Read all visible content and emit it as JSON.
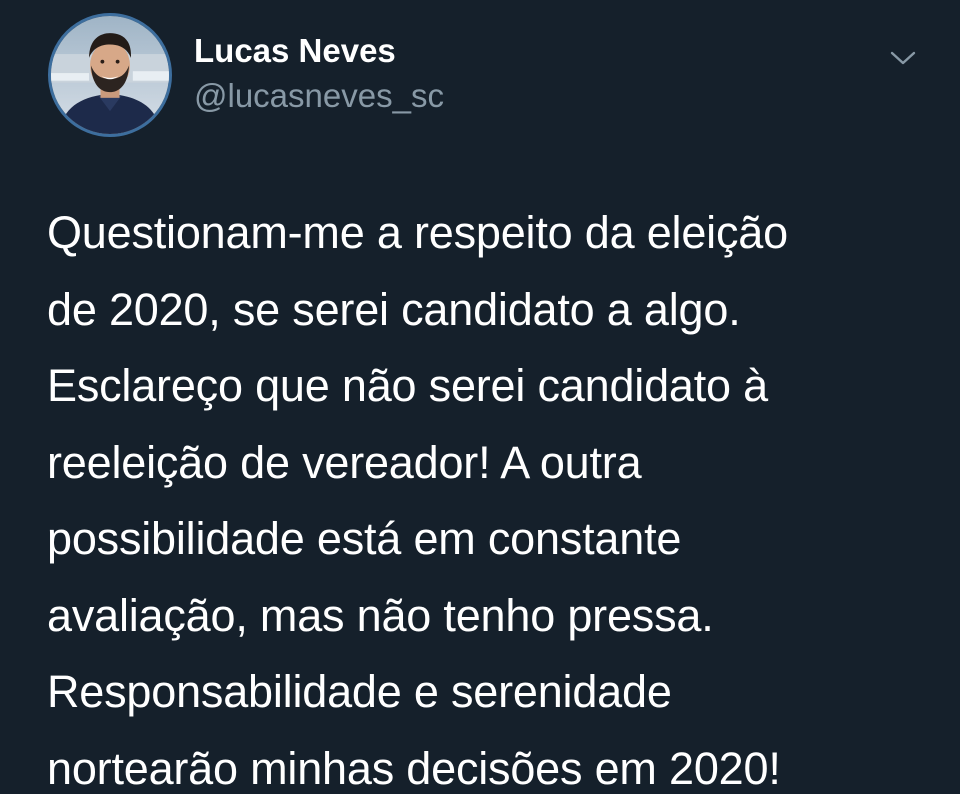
{
  "user": {
    "display_name": "Lucas Neves",
    "handle": "@lucasneves_sc",
    "avatar_icon": "profile-photo"
  },
  "header": {
    "more_icon": "chevron-down-icon"
  },
  "tweet": {
    "lines": [
      "Questionam-me a respeito da eleição",
      "de 2020, se serei candidato a algo.",
      "Esclareço que não serei candidato à",
      "reeleição de vereador! A outra",
      "possibilidade está em constante",
      "avaliação, mas não tenho pressa.",
      "Responsabilidade e serenidade",
      "nortearão minhas decisões em 2020!"
    ]
  },
  "colors": {
    "background": "#15202b",
    "text": "#ffffff",
    "secondary_text": "#8899a6",
    "avatar_ring": "#3d6e9e"
  }
}
